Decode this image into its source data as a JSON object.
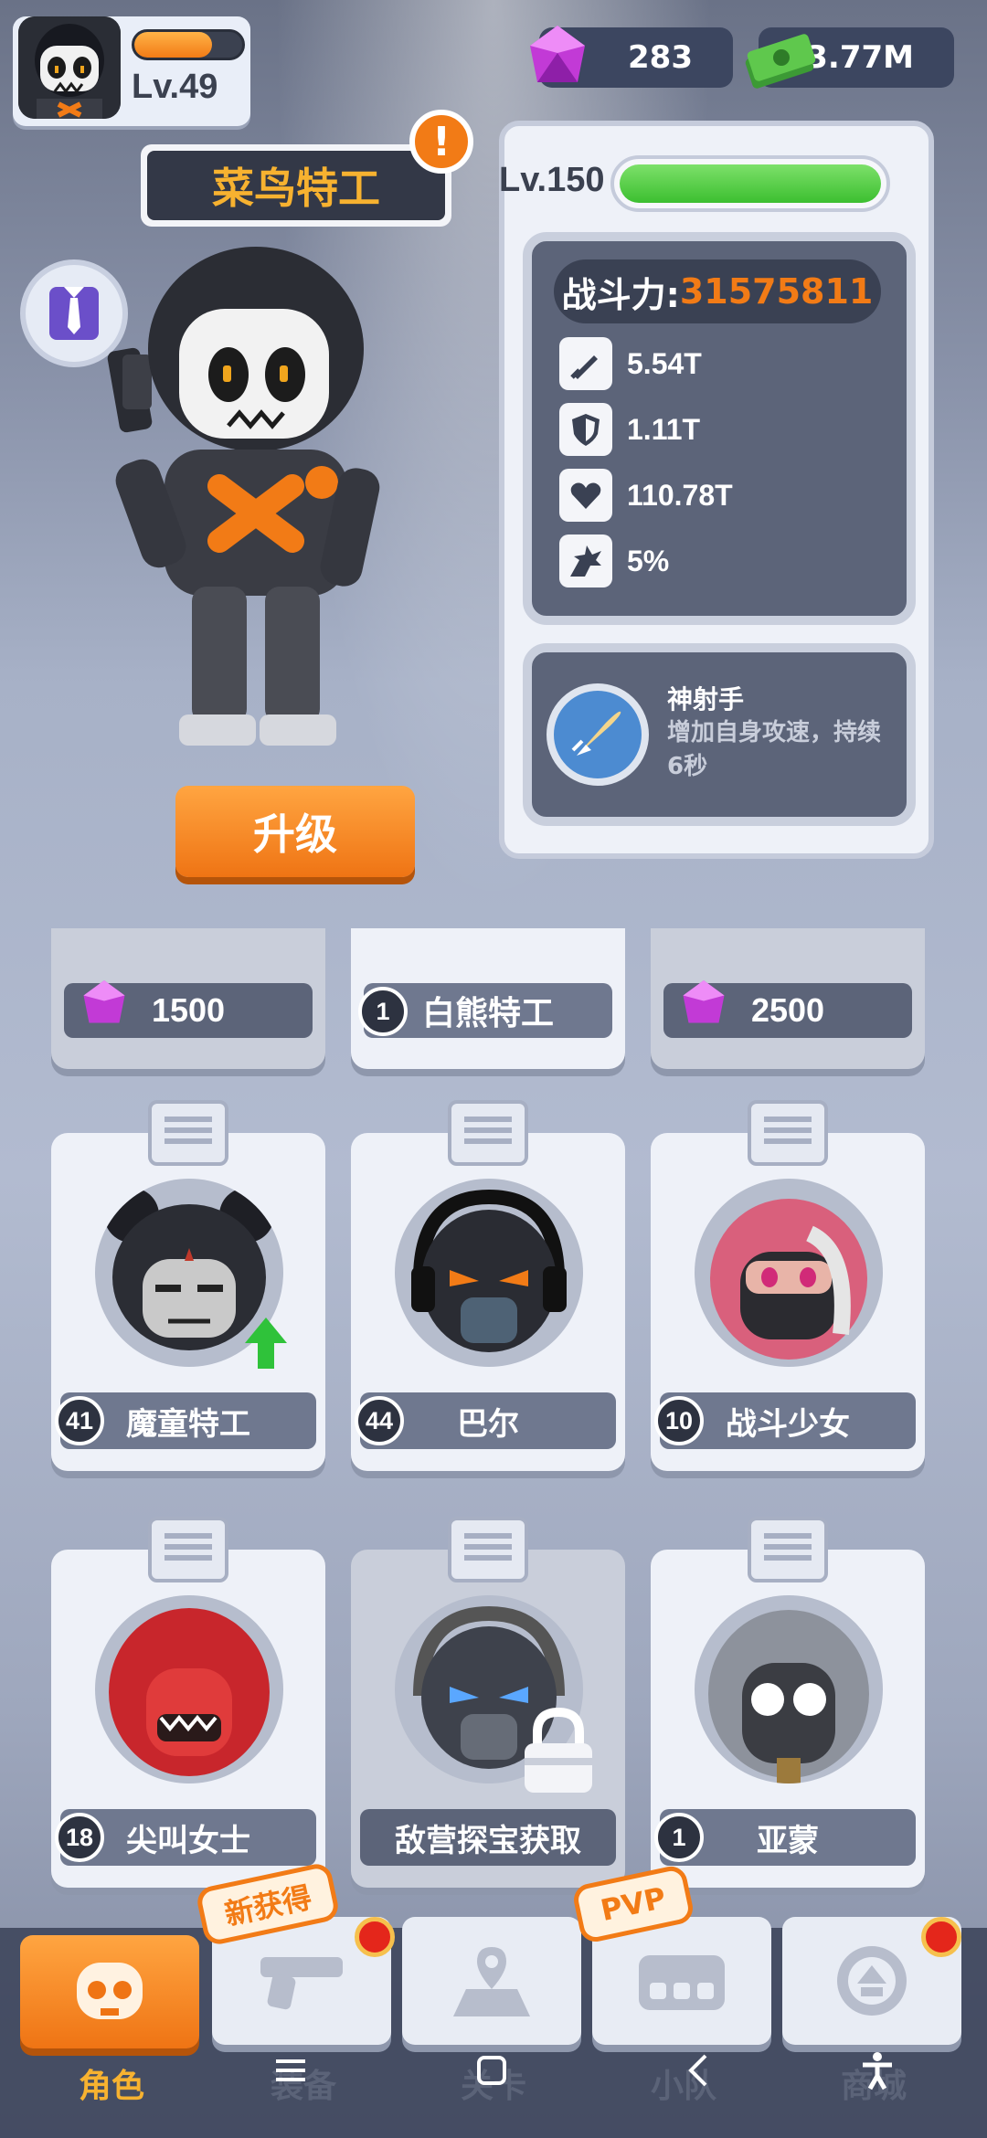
{
  "player": {
    "level": "Lv.49",
    "xp_progress": 0.72
  },
  "currency": {
    "gems": "283",
    "cash": "13.77M"
  },
  "hero": {
    "name": "菜鸟特工",
    "alert_badge": "!",
    "level": "Lv.150",
    "hp_progress": 1.0,
    "power_label": "战斗力:",
    "power_value": "31575811",
    "stats": [
      {
        "icon": "bullet-icon",
        "value": "5.54T"
      },
      {
        "icon": "shield-icon",
        "value": "1.11T"
      },
      {
        "icon": "heart-icon",
        "value": "110.78T"
      },
      {
        "icon": "crit-icon",
        "value": "5%"
      }
    ],
    "skill": {
      "name": "神射手",
      "description": "增加自身攻速，持续6秒"
    },
    "upgrade_label": "升级"
  },
  "partial_row": [
    {
      "type": "gem",
      "price": "1500"
    },
    {
      "type": "level",
      "level": "1",
      "name": "白熊特工"
    },
    {
      "type": "gem",
      "price": "2500"
    }
  ],
  "characters": [
    {
      "level": "41",
      "name": "魔童特工",
      "upgrade": true,
      "locked": false
    },
    {
      "level": "44",
      "name": "巴尔",
      "upgrade": false,
      "locked": false
    },
    {
      "level": "10",
      "name": "战斗少女",
      "upgrade": false,
      "locked": false
    },
    {
      "level": "18",
      "name": "尖叫女士",
      "upgrade": false,
      "locked": false
    },
    {
      "level": "",
      "name": "敌营探宝获取",
      "upgrade": false,
      "locked": true
    },
    {
      "level": "1",
      "name": "亚蒙",
      "upgrade": false,
      "locked": false
    }
  ],
  "nav": {
    "tabs": [
      {
        "label": "角色",
        "icon": "skull-icon",
        "active": true
      },
      {
        "label": "装备",
        "icon": "gun-icon",
        "active": false
      },
      {
        "label": "关卡",
        "icon": "map-icon",
        "active": false
      },
      {
        "label": "小队",
        "icon": "squad-icon",
        "active": false
      },
      {
        "label": "商城",
        "icon": "shop-icon",
        "active": false
      }
    ],
    "new_ribbon": "新获得",
    "pvp_ribbon": "PVP"
  },
  "colors": {
    "accent_orange": "#f27b16",
    "gold_text": "#f7b230",
    "hp_green": "#3cbf30",
    "panel_dark": "#5c6479"
  }
}
